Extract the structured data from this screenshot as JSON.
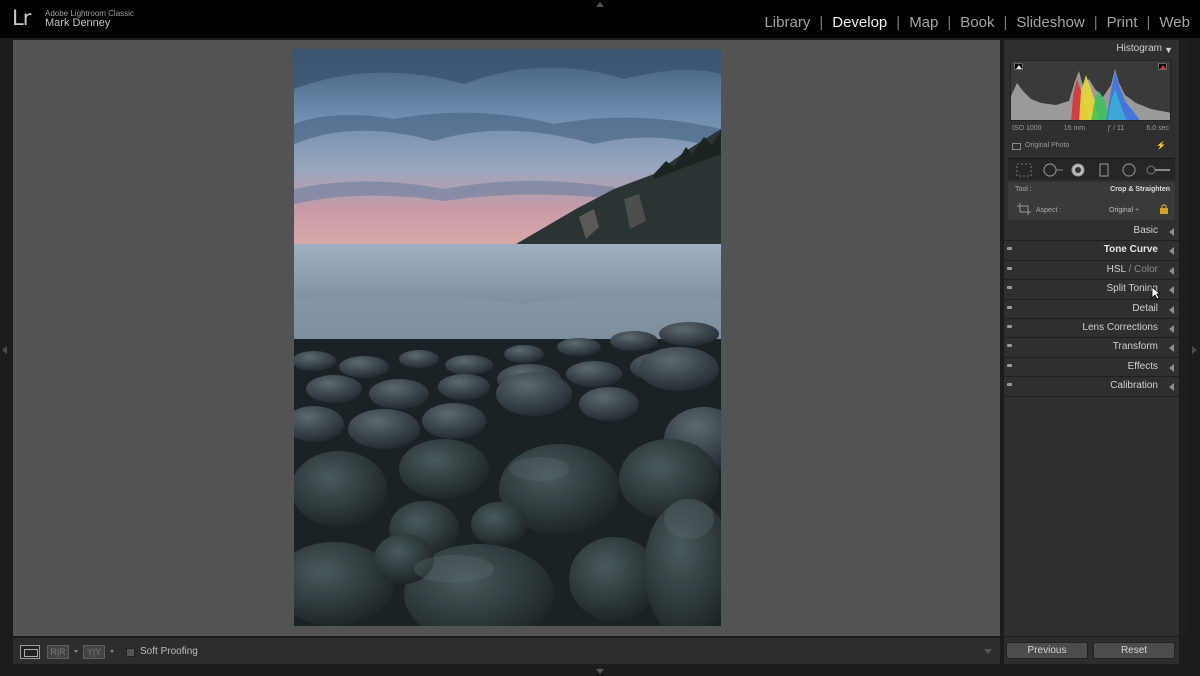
{
  "app": {
    "logo": "Lr",
    "app_name": "Adobe Lightroom Classic",
    "user": "Mark Denney"
  },
  "modules": [
    {
      "label": "Library",
      "active": false
    },
    {
      "label": "Develop",
      "active": true
    },
    {
      "label": "Map",
      "active": false
    },
    {
      "label": "Book",
      "active": false
    },
    {
      "label": "Slideshow",
      "active": false
    },
    {
      "label": "Print",
      "active": false
    },
    {
      "label": "Web",
      "active": false
    }
  ],
  "toolbar": {
    "before_after_1": "R|R",
    "before_after_2": "Y|Y",
    "soft_proofing": "Soft Proofing"
  },
  "histogram": {
    "title": "Histogram",
    "toggle": "▼",
    "iso": "ISO 1000",
    "focal": "16 mm",
    "aperture": "ƒ / 11",
    "shutter": "6.0 sec",
    "original_photo": "Original Photo"
  },
  "tool": {
    "label": "Tool :",
    "value": "Crop & Straighten",
    "aspect_label": "Aspect :",
    "aspect_value": "Original ÷"
  },
  "sections": [
    {
      "label": "Basic",
      "bold": false
    },
    {
      "label": "Tone Curve",
      "bold": true
    },
    {
      "label": "HSL",
      "suffix": "Color",
      "bold": false
    },
    {
      "label": "Split Toning",
      "bold": false
    },
    {
      "label": "Detail",
      "bold": false
    },
    {
      "label": "Lens Corrections",
      "bold": false
    },
    {
      "label": "Transform",
      "bold": false
    },
    {
      "label": "Effects",
      "bold": false
    },
    {
      "label": "Calibration",
      "bold": false
    }
  ],
  "buttons": {
    "previous": "Previous",
    "reset": "Reset"
  },
  "colors": {
    "accent_active": "#f0f0f0",
    "panel_bg": "#2f2f2f",
    "center_bg": "#535353"
  }
}
